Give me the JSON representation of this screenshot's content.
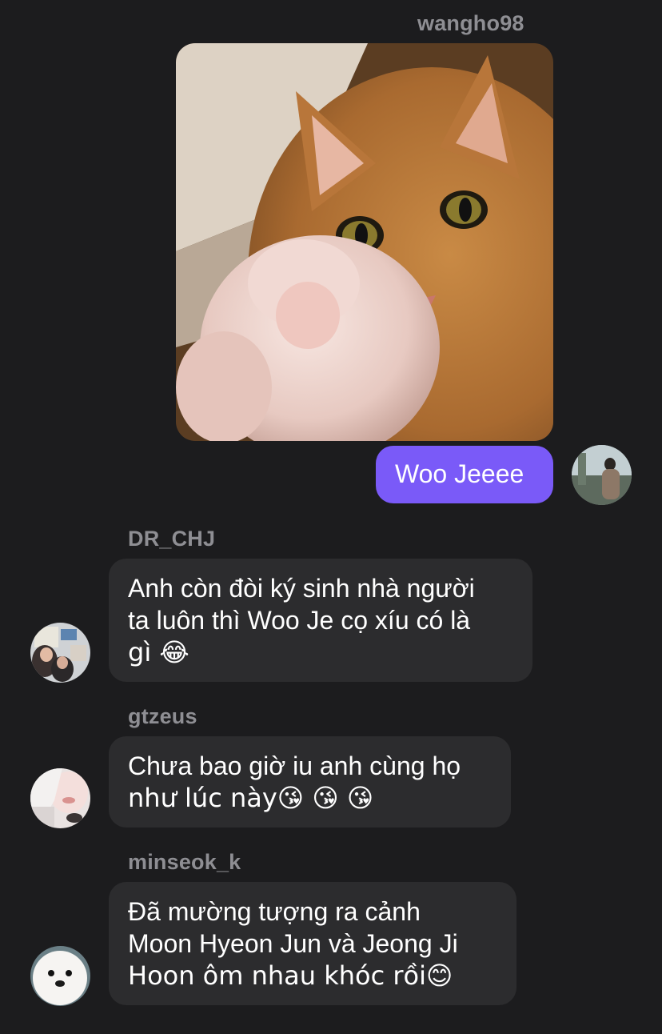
{
  "messages": [
    {
      "sender": "wangho98",
      "direction": "outgoing",
      "image": "cat-pointing-photo",
      "text": "Woo Jeeee",
      "avatar": "man-standing-avatar"
    },
    {
      "sender": "DR_CHJ",
      "direction": "incoming",
      "lines": [
        "Anh còn đòi ký sinh nhà người",
        "ta luôn thì Woo Je cọ xíu có là",
        "gì 😂"
      ],
      "avatar": "group-photo-avatar"
    },
    {
      "sender": "gtzeus",
      "direction": "incoming",
      "lines": [
        "Chưa bao giờ iu anh cùng họ",
        "như lúc này😘 😘 😘"
      ],
      "avatar": "selfie-avatar"
    },
    {
      "sender": "minseok_k",
      "direction": "incoming",
      "lines": [
        "Đã mường tượng ra cảnh",
        "Moon Hyeon Jun và Jeong Ji",
        "Hoon ôm nhau khóc rồi😊"
      ],
      "avatar": "white-dog-avatar"
    }
  ],
  "colors": {
    "background": "#1c1c1e",
    "incoming_bubble": "#2c2c2e",
    "outgoing_bubble": "#7a5af8",
    "sender_name": "#8e8e93"
  }
}
